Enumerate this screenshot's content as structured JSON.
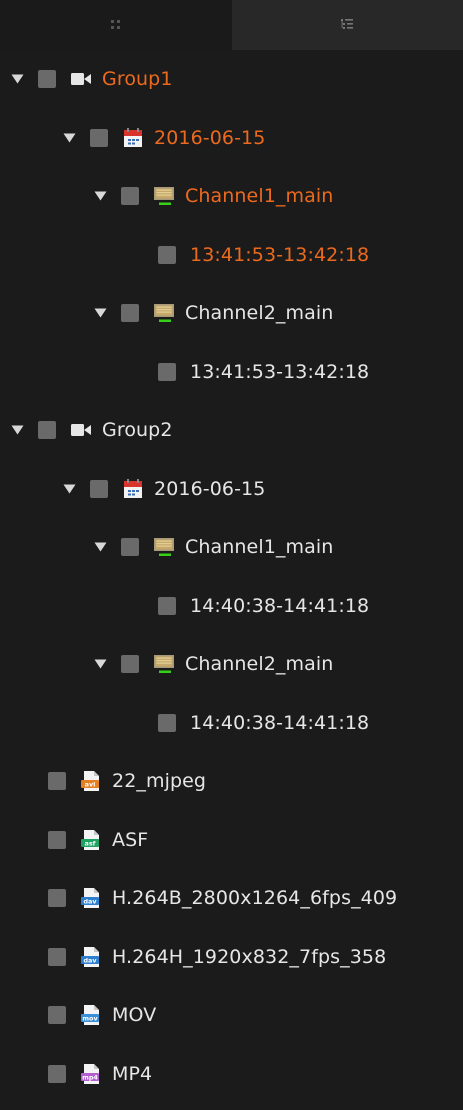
{
  "colors": {
    "background": "#1b1b1b",
    "text": "#e6e6e6",
    "selected_text": "#ec6a1e",
    "checkbox": "#6a6a6a",
    "avi_icon": "#e67e22",
    "asf_icon": "#1fa363",
    "dav_icon": "#2f7fd1",
    "mov_icon": "#3a8fd6",
    "mp4_icon": "#b25fd0"
  },
  "tabs": [
    {
      "name": "grid-view-tab",
      "icon": "grid-icon"
    },
    {
      "name": "list-view-tab",
      "icon": "tree-list-icon"
    }
  ],
  "tree": {
    "groups": [
      {
        "label": "Group1",
        "selected": true,
        "date": {
          "label": "2016-06-15",
          "selected": true,
          "channels": [
            {
              "label": "Channel1_main",
              "selected": true,
              "clip": {
                "label": "13:41:53-13:42:18",
                "selected": true
              }
            },
            {
              "label": "Channel2_main",
              "selected": false,
              "clip": {
                "label": "13:41:53-13:42:18",
                "selected": false
              }
            }
          ]
        }
      },
      {
        "label": "Group2",
        "selected": false,
        "date": {
          "label": "2016-06-15",
          "selected": false,
          "channels": [
            {
              "label": "Channel1_main",
              "selected": false,
              "clip": {
                "label": "14:40:38-14:41:18",
                "selected": false
              }
            },
            {
              "label": "Channel2_main",
              "selected": false,
              "clip": {
                "label": "14:40:38-14:41:18",
                "selected": false
              }
            }
          ]
        }
      }
    ],
    "files": [
      {
        "label": "22_mjpeg",
        "icon": "avi-file-icon",
        "badge": "avi"
      },
      {
        "label": "ASF",
        "icon": "asf-file-icon",
        "badge": "asf"
      },
      {
        "label": "H.264B_2800x1264_6fps_409",
        "icon": "dav-file-icon",
        "badge": "dav"
      },
      {
        "label": "H.264H_1920x832_7fps_358",
        "icon": "dav-file-icon",
        "badge": "dav"
      },
      {
        "label": "MOV",
        "icon": "mov-file-icon",
        "badge": "mov"
      },
      {
        "label": "MP4",
        "icon": "mp4-file-icon",
        "badge": "mp4"
      }
    ]
  }
}
